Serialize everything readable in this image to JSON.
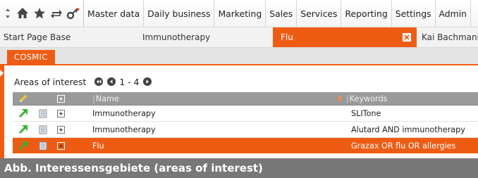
{
  "menubar": {
    "icons": [
      "updown-arrows-icon",
      "home-icon",
      "star-icon",
      "refresh-icon",
      "key-icon"
    ],
    "items": [
      "Master data",
      "Daily business",
      "Marketing",
      "Sales",
      "Services",
      "Reporting",
      "Settings",
      "Admin"
    ]
  },
  "tabs": [
    {
      "label": "Start Page Base"
    },
    {
      "label": "Immunotherapy"
    },
    {
      "label": "Flu",
      "active": true
    },
    {
      "label": "Kai Bachmann"
    }
  ],
  "subtab": {
    "label": "COSMIC"
  },
  "section": {
    "title": "Areas of interest",
    "range": "1 - 4"
  },
  "table": {
    "columns": {
      "name": "Name",
      "keywords": "Keywords"
    },
    "rows": [
      {
        "name": "Immunotherapy",
        "keywords": "SLITone",
        "selected": false
      },
      {
        "name": "Immunotherapy",
        "keywords": "Alutard AND immunotherapy",
        "selected": false
      },
      {
        "name": "Flu",
        "keywords": "Grazax OR flu OR allergies",
        "selected": true
      }
    ]
  },
  "caption": "Abb. Interessensgebiete (areas of interest)",
  "colors": {
    "accent": "#ee5c14",
    "header_gray": "#9a9a9a",
    "caption_gray": "#787878",
    "action_green": "#3cb034"
  }
}
